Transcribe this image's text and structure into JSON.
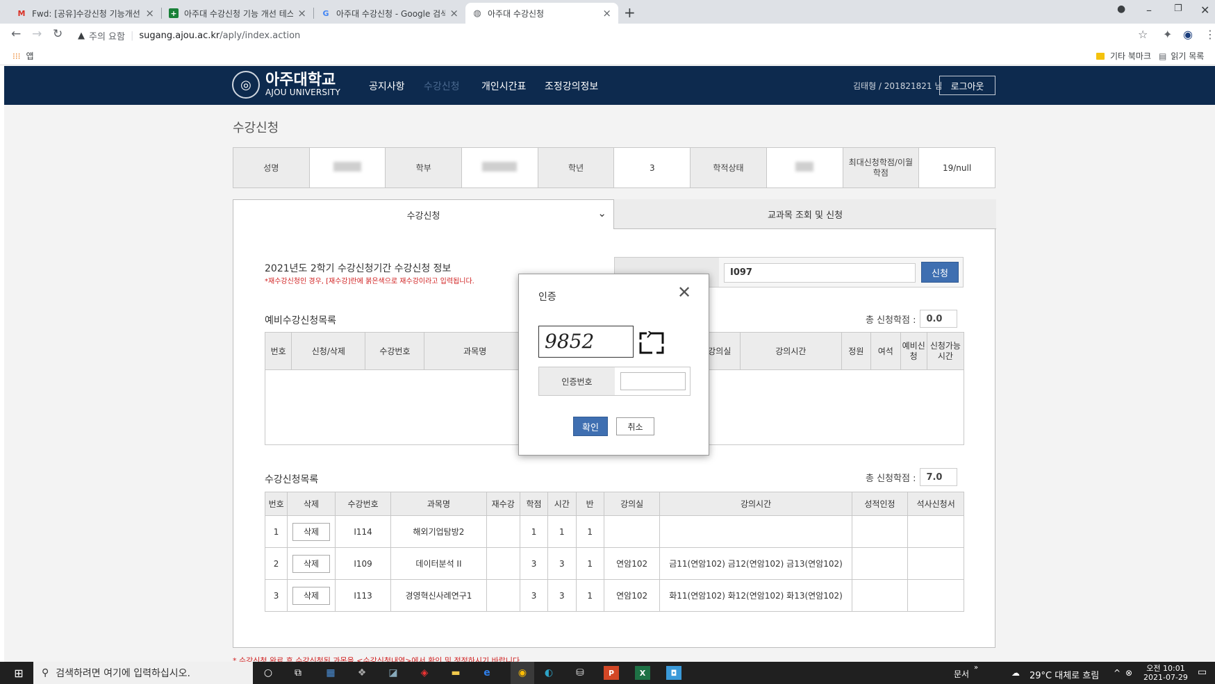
{
  "browser": {
    "tabs": [
      {
        "title": "Fwd: [공유]수강신청 기능개선 ㅌ",
        "icon": "gmail-icon"
      },
      {
        "title": "아주대 수강신청 기능 개선 테스",
        "icon": "sheets-icon"
      },
      {
        "title": "아주대 수강신청 - Google 검색",
        "icon": "google-icon"
      },
      {
        "title": "아주대 수강신청",
        "icon": "globe-icon"
      }
    ],
    "new_tab": "+",
    "url_warning": "주의 요함",
    "url_host": "sugang.ajou.ac.kr",
    "url_path": "/aply/index.action",
    "bookmarks_apps": "앱",
    "bookmarks_other": "기타 북마크",
    "reading_list": "읽기 목록"
  },
  "site": {
    "logo_kr": "아주대학교",
    "logo_en": "AJOU UNIVERSITY",
    "menu": [
      "공지사항",
      "수강신청",
      "개인시간표",
      "조정강의정보"
    ],
    "user": "김태형 / 201821821 님",
    "logout": "로그아웃",
    "page_title": "수강신청"
  },
  "info": {
    "name_label": "성명",
    "dept_label": "학부",
    "year_label": "학년",
    "year_value": "3",
    "status_label": "학적상태",
    "max_label": "최대신청학점/이월학점",
    "max_value": "19/null"
  },
  "tabs": {
    "left": "수강신청",
    "right": "교과목 조회 및 신청"
  },
  "apply": {
    "heading": "2021년도 2학기 수강신청기간 수강신청 정보",
    "notice": "*재수강신청인 경우, [재수강]란에 붉은색으로 재수강이라고 입력됩니다.",
    "input_value": "I097",
    "apply_button": "신청"
  },
  "pre_list": {
    "title": "예비수강신청목록",
    "credit_label": "총 신청학점 :",
    "credit_value": "0.0",
    "headers": [
      "번호",
      "신청/삭제",
      "수강번호",
      "과목명",
      "",
      "",
      "강의실",
      "강의시간",
      "정원",
      "여석",
      "예비신청",
      "신청가능시간"
    ]
  },
  "enrolled": {
    "title": "수강신청목록",
    "credit_label": "총 신청학점 :",
    "credit_value": "7.0",
    "headers": [
      "번호",
      "삭제",
      "수강번호",
      "과목명",
      "재수강",
      "학점",
      "시간",
      "반",
      "강의실",
      "강의시간",
      "성적인정",
      "석사신청서"
    ],
    "delete_label": "삭제",
    "rows": [
      {
        "no": "1",
        "code": "I114",
        "name": "해외기업탐방2",
        "retake": "",
        "credit": "1",
        "hours": "1",
        "section": "1",
        "room": "",
        "time": ""
      },
      {
        "no": "2",
        "code": "I109",
        "name": "데이터분석 II",
        "retake": "",
        "credit": "3",
        "hours": "3",
        "section": "1",
        "room": "연암102",
        "time": "금11(연암102) 금12(연암102) 금13(연암102)"
      },
      {
        "no": "3",
        "code": "I113",
        "name": "경영혁신사례연구1",
        "retake": "",
        "credit": "3",
        "hours": "3",
        "section": "1",
        "room": "연암102",
        "time": "화11(연암102) 화12(연암102) 화13(연암102)"
      }
    ]
  },
  "bottom_note": "* 수강신청 완료 후 수강신청된 과목을 <수강신청내역>에서 확인 및 정정하시기 바랍니다.",
  "modal": {
    "title": "인증",
    "captcha": "9852",
    "auth_label": "인증번호",
    "auth_value": "",
    "confirm": "확인",
    "cancel": "취소"
  },
  "taskbar": {
    "search_placeholder": "검색하려면 여기에 입력하십시오.",
    "docs": "문서",
    "weather": "29°C 대체로 흐림",
    "time": "오전 10:01",
    "date": "2021-07-29"
  },
  "colors": {
    "nav_bg": "#0d2a4e",
    "accent_blue": "#3f6fb1",
    "notice_red": "#d02020"
  }
}
